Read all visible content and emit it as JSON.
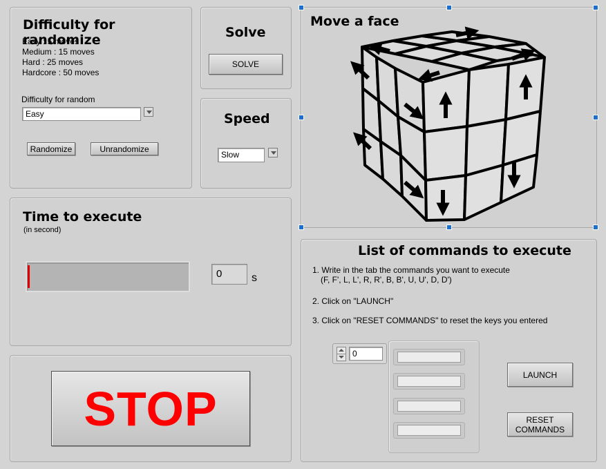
{
  "difficulty": {
    "title": "Difficulty for randomize",
    "levels": [
      "Easy : 5 moves",
      "Medium : 15 moves",
      "Hard : 25 moves",
      "Hardcore : 50 moves"
    ],
    "select_label": "Difficulty for random",
    "select_value": "Easy",
    "randomize_label": "Randomize",
    "unrandomize_label": "Unrandomize"
  },
  "solve": {
    "title": "Solve",
    "button_label": "SOLVE"
  },
  "speed": {
    "title": "Speed",
    "select_value": "Slow"
  },
  "face": {
    "title": "Move a face"
  },
  "time": {
    "title": "Time to execute",
    "subtitle": "(in second)",
    "progress": 0.0,
    "value": "0",
    "unit": "s"
  },
  "stop": {
    "label": "STOP",
    "color": "#ff0000"
  },
  "commands": {
    "title": "List of commands to execute",
    "step1": "1. Write in the tab the commands you want to execute",
    "step1b": "(F, F', L, L', R, R', B, B', U, U', D, D')",
    "step2": "2. Click on \"LAUNCH\"",
    "step3": "3. Click on \"RESET COMMANDS\" to reset the keys you entered",
    "index_value": "0",
    "entries": [
      "",
      "",
      "",
      ""
    ],
    "launch_label": "LAUNCH",
    "reset_label_line1": "RESET",
    "reset_label_line2": "COMMANDS"
  }
}
